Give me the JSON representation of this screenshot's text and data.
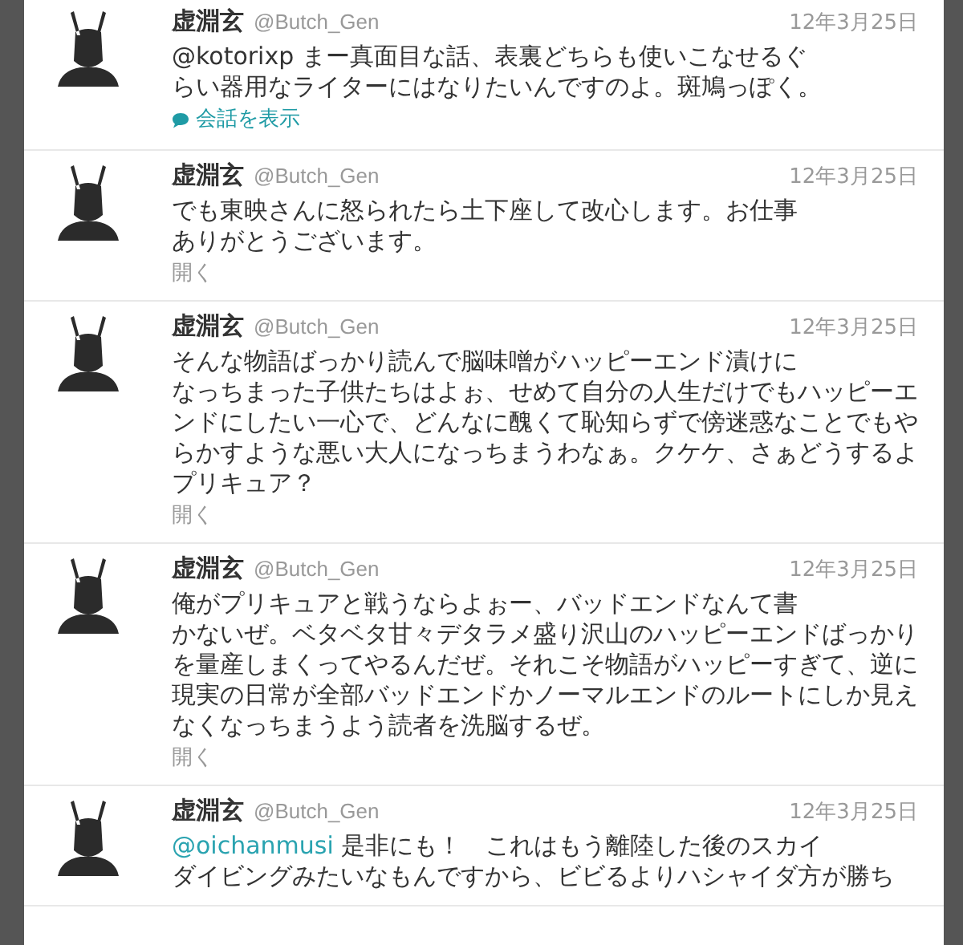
{
  "tweets": [
    {
      "name": "虚淵玄",
      "handle": "@Butch_Gen",
      "date": "12年3月25日",
      "mention": "@kotorixp",
      "mention_highlighted": false,
      "lines": [
        "まー真面目な話、表裏どちらも使いこなせるぐ",
        "らい器用なライターにはなりたいんですのよ。斑鳩っぽく。"
      ],
      "footer": {
        "kind": "conversation",
        "label": "会話を表示"
      }
    },
    {
      "name": "虚淵玄",
      "handle": "@Butch_Gen",
      "date": "12年3月25日",
      "lines": [
        "でも東映さんに怒られたら土下座して改心します。お仕事",
        "ありがとうございます。"
      ],
      "footer": {
        "kind": "expand",
        "label": "開く"
      }
    },
    {
      "name": "虚淵玄",
      "handle": "@Butch_Gen",
      "date": "12年3月25日",
      "lines": [
        "そんな物語ばっかり読んで脳味噌がハッピーエンド漬けに",
        "なっちまった子供たちはよぉ、せめて自分の人生だけでもハッピーエ",
        "ンドにしたい一心で、どんなに醜くて恥知らずで傍迷惑なことでもや",
        "らかすような悪い大人になっちまうわなぁ。クケケ、さぁどうするよ",
        "プリキュア？"
      ],
      "footer": {
        "kind": "expand",
        "label": "開く"
      }
    },
    {
      "name": "虚淵玄",
      "handle": "@Butch_Gen",
      "date": "12年3月25日",
      "lines": [
        "俺がプリキュアと戦うならよぉー、バッドエンドなんて書",
        "かないぜ。ベタベタ甘々デタラメ盛り沢山のハッピーエンドばっかり",
        "を量産しまくってやるんだぜ。それこそ物語がハッピーすぎて、逆に",
        "現実の日常が全部バッドエンドかノーマルエンドのルートにしか見え",
        "なくなっちまうよう読者を洗脳するぜ。"
      ],
      "footer": {
        "kind": "expand",
        "label": "開く"
      }
    },
    {
      "name": "虚淵玄",
      "handle": "@Butch_Gen",
      "date": "12年3月25日",
      "mention": "@oichanmusi",
      "mention_highlighted": true,
      "lines": [
        "是非にも！　これはもう離陸した後のスカイ",
        "ダイビングみたいなもんですから、ビビるよりハシャイダ方が勝ち"
      ]
    }
  ]
}
